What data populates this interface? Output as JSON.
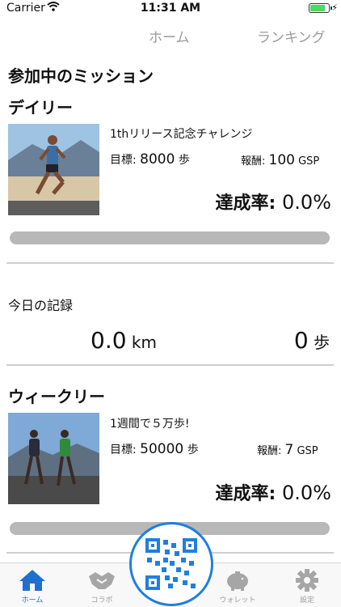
{
  "status_bar": {
    "carrier": "Carrier",
    "time": "11:31 AM"
  },
  "top_tabs": {
    "home": "ホーム",
    "ranking": "ランキング"
  },
  "section_title": "参加中のミッション",
  "daily": {
    "heading": "デイリー",
    "mission_title": "1thリリース記念チャレンジ",
    "goal_label": "目標: ",
    "goal_value": "8000",
    "goal_unit": " 歩",
    "reward_label": "報酬: ",
    "reward_value": "100",
    "reward_unit": " GSP",
    "rate_label": "達成率: ",
    "rate_value": "0.0%",
    "progress": 0.0
  },
  "today": {
    "title": "今日の記録",
    "distance": "0.0",
    "distance_unit": " km",
    "steps": "0",
    "steps_unit": " 歩"
  },
  "weekly": {
    "heading": "ウィークリー",
    "mission_title": "1週間で５万歩!",
    "goal_label": "目標: ",
    "goal_value": "50000",
    "goal_unit": " 歩",
    "reward_label": "報酬: ",
    "reward_value": "7",
    "reward_unit": " GSP",
    "rate_label": "達成率: ",
    "rate_value": "0.0%",
    "progress": 0.0
  },
  "tab_bar": {
    "home": "ホーム",
    "collab": "コラボ",
    "wallet": "ウォレット",
    "settings": "設定"
  },
  "icons": {
    "home": "home-icon",
    "collab": "handshake-icon",
    "qr": "qr-code-icon",
    "wallet": "piggy-bank-icon",
    "settings": "gear-icon"
  },
  "colors": {
    "accent": "#1f7fe0",
    "active_tab": "#1f6fd1",
    "inactive": "#9b9b9b",
    "bar_track": "#b8b8b8"
  }
}
